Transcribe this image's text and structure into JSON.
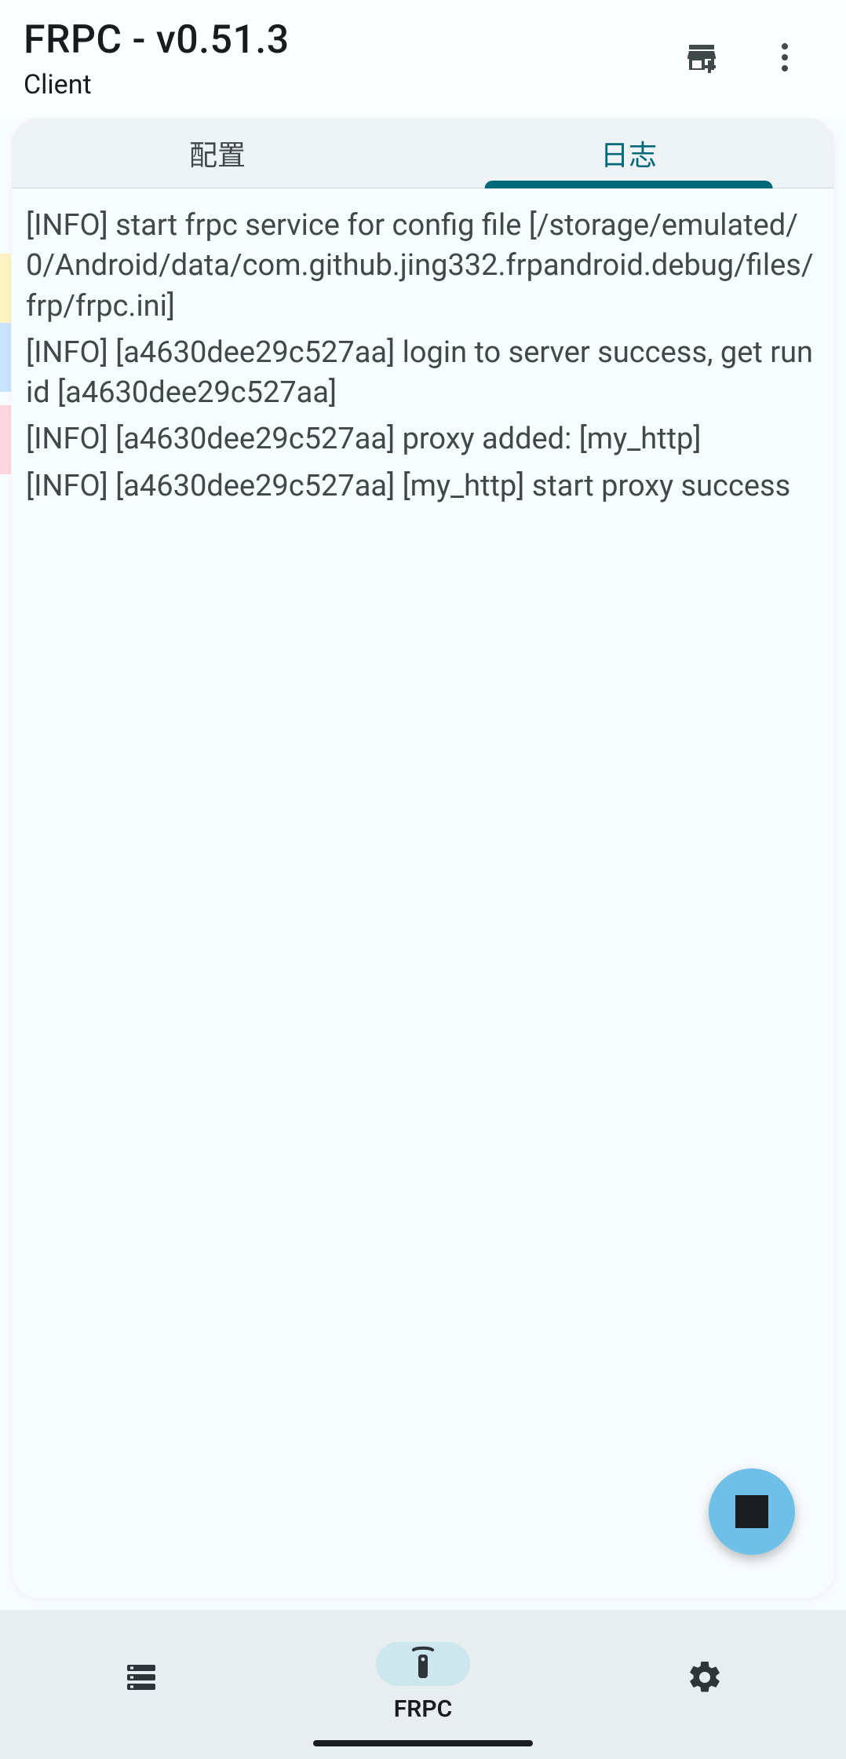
{
  "header": {
    "title": "FRPC - v0.51.3",
    "subtitle": "Client"
  },
  "tabs": {
    "config_label": "配置",
    "log_label": "日志",
    "active_index": 1
  },
  "logs": [
    "[INFO] start frpc service for config file [/storage/emulated/0/Android/data/com.github.jing332.frpandroid.debug/files/frp/frpc.ini]",
    "[INFO] [a4630dee29c527aa] login to server success, get run id [a4630dee29c527aa]",
    "[INFO] [a4630dee29c527aa] proxy added: [my_http]",
    "[INFO] [a4630dee29c527aa] [my_http] start proxy success"
  ],
  "bottom_nav": {
    "items": [
      {
        "label": "",
        "icon": "server"
      },
      {
        "label": "FRPC",
        "icon": "remote",
        "active": true
      },
      {
        "label": "",
        "icon": "gear"
      }
    ]
  },
  "icons": {
    "store_add": "store-add-icon",
    "more": "more-vert-icon",
    "stop": "stop-icon"
  }
}
